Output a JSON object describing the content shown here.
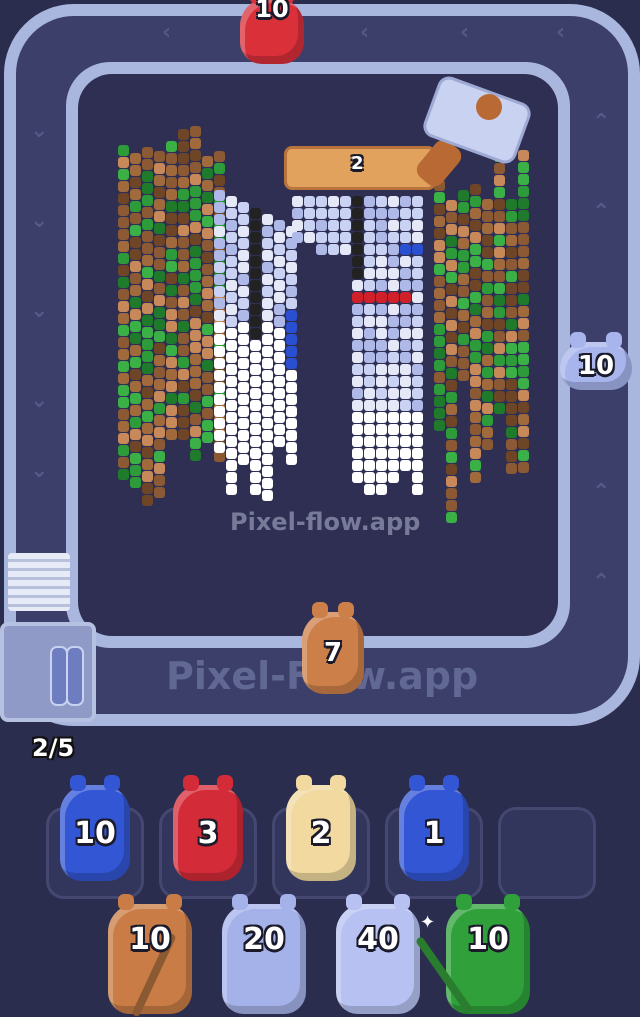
{
  "game": {
    "watermark_board": "Pixel-flow.app",
    "watermark_track": "Pixel-Flow.app",
    "crate_count": "2",
    "queue_counter": "2/5",
    "track_pigs": [
      {
        "name": "red",
        "value": "10",
        "color": "#d9303a"
      },
      {
        "name": "lavender",
        "value": "10",
        "color": "#a8b4ec"
      },
      {
        "name": "brown",
        "value": "7",
        "color": "#cc7f49"
      }
    ],
    "slot_pigs": [
      {
        "name": "blue",
        "value": "10",
        "color": "#3356d4"
      },
      {
        "name": "red",
        "value": "3",
        "color": "#d42b38"
      },
      {
        "name": "cream",
        "value": "2",
        "color": "#f1d9a0"
      },
      {
        "name": "blue",
        "value": "1",
        "color": "#3356d4"
      }
    ],
    "bottom_pigs": [
      {
        "name": "brown",
        "value": "10",
        "color": "#c97c45"
      },
      {
        "name": "lavender",
        "value": "20",
        "color": "#a5b2ea"
      },
      {
        "name": "lavender",
        "value": "40",
        "color": "#b7c2f2"
      },
      {
        "name": "green",
        "value": "10",
        "color": "#2fa03a"
      }
    ]
  }
}
